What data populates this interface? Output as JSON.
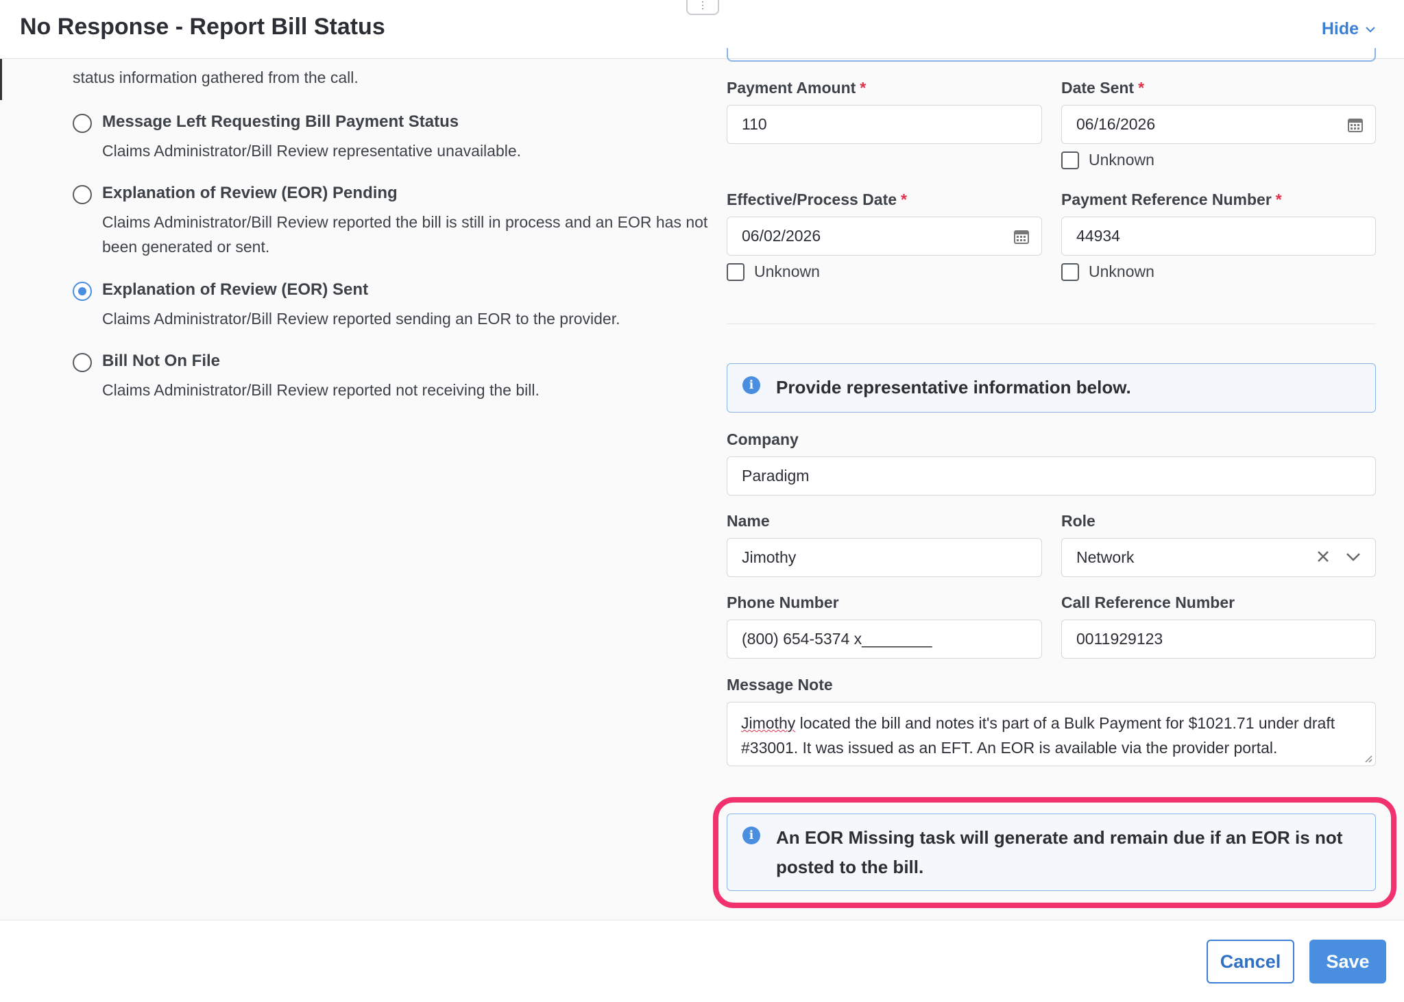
{
  "header": {
    "title": "No Response - Report Bill Status",
    "hide_label": "Hide"
  },
  "left": {
    "intro_text": "status information gathered from the call.",
    "options": [
      {
        "label": "Message Left Requesting Bill Payment Status",
        "desc": "Claims Administrator/Bill Review representative unavailable.",
        "checked": false
      },
      {
        "label": "Explanation of Review (EOR) Pending",
        "desc": "Claims Administrator/Bill Review reported the bill is still in process and an EOR has not been generated or sent.",
        "checked": false
      },
      {
        "label": "Explanation of Review (EOR) Sent",
        "desc": "Claims Administrator/Bill Review reported sending an EOR to the provider.",
        "checked": true
      },
      {
        "label": "Bill Not On File",
        "desc": "Claims Administrator/Bill Review reported not receiving the bill.",
        "checked": false
      }
    ]
  },
  "payment": {
    "amount_label": "Payment Amount",
    "amount_value": "110",
    "date_sent_label": "Date Sent",
    "date_sent_value": "06/16/2026",
    "effective_label": "Effective/Process Date",
    "effective_value": "06/02/2026",
    "ref_label": "Payment Reference Number",
    "ref_value": "44934",
    "required_mark": "*",
    "unknown_label": "Unknown"
  },
  "rep": {
    "info_text": "Provide representative information below.",
    "company_label": "Company",
    "company_value": "Paradigm",
    "name_label": "Name",
    "name_value": "Jimothy",
    "role_label": "Role",
    "role_value": "Network",
    "phone_label": "Phone Number",
    "phone_value": "(800) 654-5374 x________",
    "call_ref_label": "Call Reference Number",
    "call_ref_value": "0011929123",
    "note_label": "Message Note",
    "note_name": "Jimothy",
    "note_rest": " located the bill and notes it's part of a Bulk Payment for $1021.71 under draft #33001. It was issued as an EFT. An EOR is available via the provider portal."
  },
  "eor_notice": {
    "text": "An EOR Missing task will generate and remain due if an EOR is not posted to the bill."
  },
  "footer": {
    "cancel_label": "Cancel",
    "save_label": "Save"
  },
  "colors": {
    "accent": "#4a8ee0",
    "required": "#e0304a",
    "highlight": "#f2326e"
  }
}
